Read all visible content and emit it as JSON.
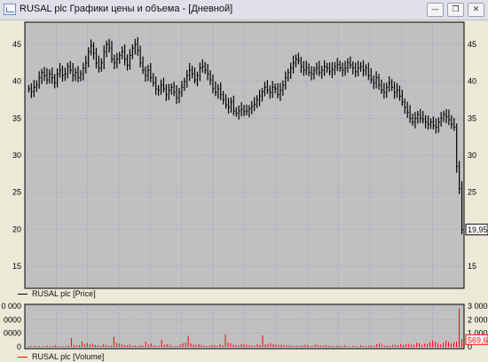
{
  "window": {
    "title": "RUSAL plc Графики цены и объема - [Дневной]",
    "minimize_glyph": "—",
    "restore_glyph": "❐",
    "close_glyph": "✕"
  },
  "colors": {
    "plot_bg": "#c0c0c0",
    "grid": "#5a7fd0",
    "price_bars": "#000000",
    "volume_bars": "#ff0000",
    "last_price_tag": "#000000",
    "last_volume_tag": "#ff0000"
  },
  "price_panel": {
    "legend": "RUSAL plc [Price]",
    "y_ticks": [
      "15",
      "20",
      "25",
      "30",
      "35",
      "40",
      "45"
    ],
    "last_value_label": "19,95"
  },
  "volume_panel": {
    "legend": "RUSAL plc [Volume]",
    "left_ticks": [
      "0",
      "0000",
      "0000",
      "0 000"
    ],
    "right_ticks": [
      "0",
      "1 000",
      "2 000",
      "3 000"
    ],
    "last_value_label": "569,6"
  },
  "chart_data": [
    {
      "type": "ohlc",
      "series": [
        {
          "name": "RUSAL plc [Price]"
        }
      ],
      "ylim": [
        12,
        48
      ],
      "y_ticks": [
        15,
        20,
        25,
        30,
        35,
        40,
        45
      ],
      "grid": true,
      "close": [
        39.0,
        38.6,
        39.2,
        39.5,
        40.5,
        41.2,
        40.8,
        40.2,
        41.0,
        40.5,
        39.8,
        41.0,
        41.5,
        40.8,
        41.0,
        42.0,
        41.5,
        40.8,
        41.2,
        40.5,
        41.0,
        41.8,
        42.5,
        44.0,
        44.8,
        43.8,
        42.5,
        41.8,
        42.5,
        44.0,
        45.0,
        44.5,
        43.0,
        42.5,
        43.0,
        43.5,
        44.0,
        43.0,
        42.2,
        43.5,
        44.5,
        45.0,
        44.2,
        42.5,
        41.5,
        40.8,
        41.5,
        40.5,
        39.8,
        39.0,
        38.8,
        39.5,
        39.0,
        38.2,
        38.8,
        39.2,
        38.5,
        37.8,
        38.5,
        39.2,
        40.0,
        40.8,
        41.5,
        41.0,
        40.2,
        40.8,
        41.8,
        42.0,
        41.5,
        41.0,
        40.2,
        39.0,
        38.5,
        39.0,
        38.2,
        37.5,
        36.8,
        36.5,
        37.2,
        36.0,
        35.7,
        36.0,
        36.2,
        35.9,
        36.0,
        36.3,
        36.6,
        36.9,
        37.5,
        38.0,
        38.6,
        39.2,
        38.8,
        38.5,
        39.2,
        39.0,
        38.2,
        38.8,
        39.5,
        40.5,
        41.2,
        41.8,
        42.5,
        43.0,
        42.8,
        42.0,
        41.5,
        41.8,
        41.2,
        41.0,
        41.5,
        41.8,
        41.2,
        41.5,
        42.0,
        41.8,
        41.3,
        41.6,
        42.0,
        42.3,
        41.8,
        41.5,
        41.8,
        42.5,
        42.2,
        41.8,
        41.3,
        41.8,
        42.0,
        41.5,
        41.8,
        40.8,
        40.2,
        39.8,
        40.5,
        39.5,
        38.8,
        38.5,
        39.2,
        39.8,
        39.2,
        38.5,
        38.8,
        38.0,
        37.2,
        36.5,
        35.8,
        35.0,
        34.5,
        35.0,
        35.5,
        35.0,
        34.8,
        34.5,
        34.2,
        34.5,
        34.0,
        33.8,
        34.5,
        35.0,
        35.5,
        35.2,
        34.8,
        34.2,
        33.8,
        28.5,
        25.5,
        19.95
      ],
      "last_value": 19.95
    },
    {
      "type": "bar",
      "series": [
        {
          "name": "RUSAL plc [Volume]"
        }
      ],
      "ylim": [
        0,
        3000
      ],
      "y_ticks": [
        0,
        1000,
        2000,
        3000
      ],
      "grid": true,
      "values": [
        60,
        45,
        80,
        55,
        70,
        40,
        65,
        90,
        50,
        75,
        120,
        60,
        45,
        55,
        80,
        100,
        650,
        150,
        90,
        130,
        400,
        220,
        300,
        180,
        250,
        150,
        120,
        90,
        200,
        160,
        80,
        110,
        750,
        300,
        260,
        200,
        150,
        120,
        180,
        90,
        110,
        70,
        140,
        95,
        400,
        180,
        260,
        120,
        90,
        110,
        520,
        150,
        200,
        170,
        90,
        60,
        80,
        180,
        270,
        320,
        800,
        260,
        180,
        160,
        220,
        150,
        90,
        70,
        120,
        140,
        130,
        100,
        200,
        130,
        900,
        300,
        270,
        180,
        150,
        130,
        220,
        190,
        160,
        140,
        110,
        90,
        200,
        140,
        850,
        180,
        200,
        280,
        210,
        170,
        150,
        160,
        130,
        150,
        120,
        100,
        90,
        110,
        80,
        120,
        160,
        140,
        70,
        60,
        180,
        130,
        120,
        110,
        140,
        90,
        80,
        70,
        100,
        60,
        75,
        130,
        50,
        40,
        90,
        70,
        60,
        130,
        80,
        70,
        100,
        120,
        90,
        210,
        270,
        160,
        80,
        110,
        100,
        150,
        170,
        130,
        210,
        140,
        200,
        230,
        180,
        160,
        300,
        270,
        150,
        250,
        230,
        360,
        480,
        390,
        260,
        180,
        290,
        450,
        360,
        270,
        350,
        390,
        2800,
        569.6
      ],
      "last_value": 569.6
    }
  ]
}
